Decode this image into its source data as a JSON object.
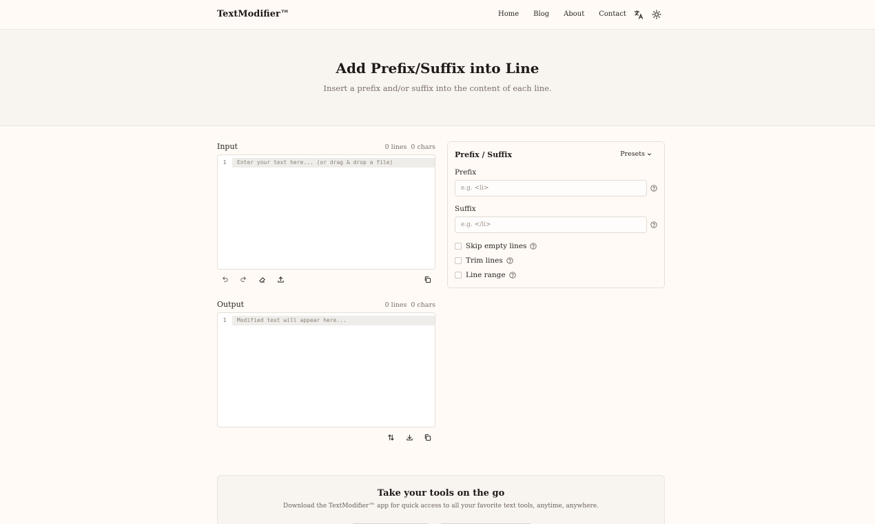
{
  "header": {
    "brand": "TextModifier™",
    "nav": [
      "Home",
      "Blog",
      "About",
      "Contact"
    ],
    "icons": [
      "translate-icon",
      "theme-toggle-icon"
    ]
  },
  "hero": {
    "title": "Add Prefix/Suffix into Line",
    "subtitle": "Insert a prefix and/or suffix into the content of each line."
  },
  "input_panel": {
    "label": "Input",
    "lines": "0 lines",
    "chars": "0 chars",
    "line_number": "1",
    "placeholder": "Enter your text here... (or drag & drop a file)"
  },
  "output_panel": {
    "label": "Output",
    "lines": "0 lines",
    "chars": "0 chars",
    "line_number": "1",
    "placeholder": "Modified text will appear here..."
  },
  "options": {
    "title": "Prefix / Suffix",
    "presets": "Presets",
    "prefix_label": "Prefix",
    "prefix_placeholder": "e.g. <li>",
    "suffix_label": "Suffix",
    "suffix_placeholder": "e.g. </li>",
    "checkboxes": [
      "Skip empty lines",
      "Trim lines",
      "Line range"
    ]
  },
  "promo": {
    "title": "Take your tools on the go",
    "text": "Download the TextModifier™ app for quick access to all your favorite text tools, anytime, anywhere."
  }
}
